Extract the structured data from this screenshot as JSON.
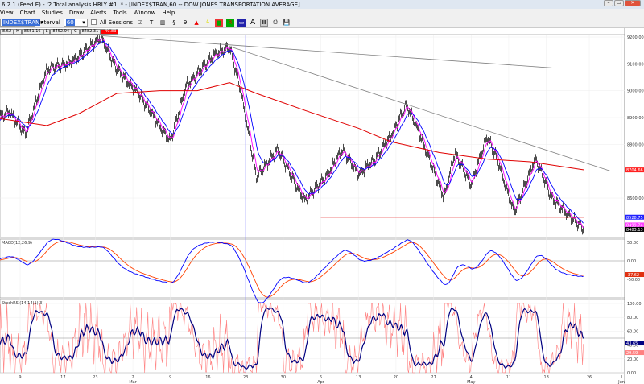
{
  "window": {
    "title": "6.2.1 (Feed E) - '2.Total analysis HRLY #1' * - [INDEX$TRAN,60 -- DOW JONES TRANSPORTATION AVERAGE]",
    "minimize": "–",
    "maximize": "▭",
    "close": "✕"
  },
  "menu": [
    "View",
    "Chart",
    "Studies",
    "Draw",
    "Alerts",
    "Tools",
    "Window",
    "Help"
  ],
  "toolbar": {
    "symbol": "INDEX$TRAN",
    "interval_label": "Interval",
    "interval": "60",
    "all_sessions": "All Sessions",
    "all_sessions_checked": false,
    "icons": [
      "check-chart-icon",
      "text-icon",
      "bars-icon",
      "spiral-icon",
      "nine-icon",
      "triangle-alert-icon",
      "lightning-icon",
      "color-bars-icon",
      "color-r-icon",
      "screen-icon",
      "font-a-icon",
      "grid-icon",
      "print-icon",
      "save-icon"
    ]
  },
  "infobar": {
    "o": "8.62",
    "h_label": "H",
    "h": "8551.16",
    "l_label": "L",
    "l": "8452.94",
    "c_label": "C",
    "c": "8482.31",
    "chg": "-40.83"
  },
  "colors": {
    "price": "#000000",
    "fast_ma": "#ff00ff",
    "mid_ma": "#0000ff",
    "slow_ma": "#e00000",
    "trendline": "#808080",
    "support": "#e00000",
    "macd": "#0000ff",
    "signal": "#ff4000",
    "stoch_k": "#ff8080",
    "stoch_d": "#000080",
    "cursor": "#4040ff"
  },
  "chart_data": {
    "type": "line",
    "title": "INDEX$TRAN,60 -- DOW JONES TRANSPORTATION AVERAGE",
    "price_axis": {
      "ticks": [
        "9200.00",
        "9100.00",
        "9000.00",
        "8900.00",
        "8800.00",
        "8600.00"
      ],
      "ylim": [
        8440,
        9215
      ]
    },
    "tags": [
      {
        "label": "8704.66",
        "value": 8704.66,
        "color": "#ff2020"
      },
      {
        "label": "8528.75",
        "value": 8528.75,
        "color": "#2020ff"
      },
      {
        "label": "8499.74",
        "value": 8499.74,
        "color": "#ff40ff"
      },
      {
        "label": "8483.13",
        "value": 8483.13,
        "color": "#000000"
      }
    ],
    "x_ticks": [
      {
        "d": "2015-02-09",
        "l": "9"
      },
      {
        "d": "2015-02-17",
        "l": "17"
      },
      {
        "d": "2015-02-23",
        "l": "23"
      },
      {
        "d": "2015-03-02",
        "l": "2",
        "m": "Mar"
      },
      {
        "d": "2015-03-09",
        "l": "9"
      },
      {
        "d": "2015-03-16",
        "l": "16"
      },
      {
        "d": "2015-03-23",
        "l": "23"
      },
      {
        "d": "2015-03-30",
        "l": "30"
      },
      {
        "d": "2015-04-06",
        "l": "6",
        "m": "Apr"
      },
      {
        "d": "2015-04-13",
        "l": "13"
      },
      {
        "d": "2015-04-20",
        "l": "20"
      },
      {
        "d": "2015-04-27",
        "l": "27"
      },
      {
        "d": "2015-05-04",
        "l": "4",
        "m": "May"
      },
      {
        "d": "2015-05-11",
        "l": "11"
      },
      {
        "d": "2015-05-18",
        "l": "18"
      },
      {
        "d": "2015-05-26",
        "l": "26"
      },
      {
        "d": "2015-06-01",
        "l": "1",
        "m": "Jun"
      }
    ],
    "close": [
      [
        "2015-02-04",
        8890
      ],
      [
        "2015-02-07",
        8920
      ],
      [
        "2015-02-10",
        8840
      ],
      [
        "2015-02-14",
        9080
      ],
      [
        "2015-02-19",
        9110
      ],
      [
        "2015-02-24",
        9200
      ],
      [
        "2015-02-27",
        9080
      ],
      [
        "2015-03-03",
        8990
      ],
      [
        "2015-03-09",
        8810
      ],
      [
        "2015-03-12",
        9020
      ],
      [
        "2015-03-17",
        9130
      ],
      [
        "2015-03-20",
        9165
      ],
      [
        "2015-03-22",
        9010
      ],
      [
        "2015-03-25",
        8680
      ],
      [
        "2015-03-29",
        8780
      ],
      [
        "2015-04-03",
        8590
      ],
      [
        "2015-04-07",
        8680
      ],
      [
        "2015-04-10",
        8780
      ],
      [
        "2015-04-13",
        8690
      ],
      [
        "2015-04-16",
        8740
      ],
      [
        "2015-04-19",
        8830
      ],
      [
        "2015-04-22",
        8950
      ],
      [
        "2015-04-25",
        8810
      ],
      [
        "2015-04-29",
        8600
      ],
      [
        "2015-05-01",
        8770
      ],
      [
        "2015-05-04",
        8650
      ],
      [
        "2015-05-07",
        8830
      ],
      [
        "2015-05-09",
        8740
      ],
      [
        "2015-05-12",
        8545
      ],
      [
        "2015-05-16",
        8750
      ],
      [
        "2015-05-19",
        8600
      ],
      [
        "2015-05-25",
        8483
      ]
    ],
    "ma200": [
      [
        "2015-02-04",
        8900
      ],
      [
        "2015-02-14",
        8870
      ],
      [
        "2015-02-20",
        8915
      ],
      [
        "2015-02-27",
        8990
      ],
      [
        "2015-03-07",
        9000
      ],
      [
        "2015-03-14",
        9000
      ],
      [
        "2015-03-20",
        9030
      ],
      [
        "2015-03-25",
        8990
      ],
      [
        "2015-04-04",
        8920
      ],
      [
        "2015-04-13",
        8860
      ],
      [
        "2015-04-19",
        8810
      ],
      [
        "2015-04-28",
        8770
      ],
      [
        "2015-05-07",
        8745
      ],
      [
        "2015-05-15",
        8735
      ],
      [
        "2015-05-25",
        8705
      ]
    ],
    "trendlines": [
      {
        "from": [
          "2015-02-24",
          9205
        ],
        "to": [
          "2015-05-19",
          9085
        ],
        "color": "#808080"
      },
      {
        "from": [
          "2015-03-20",
          9165
        ],
        "to": [
          "2015-05-30",
          8700
        ],
        "color": "#808080"
      }
    ],
    "support": {
      "from": "2015-04-06",
      "to": "2015-05-25",
      "value": 8528.75
    },
    "cursor_date": "2015-03-23",
    "macd": {
      "label": "MACD(12,26,9)",
      "ticks": [
        "50.00",
        "0.00",
        "-50.00"
      ],
      "tag": "-37.62"
    },
    "stoch": {
      "label": "StochRSI(14,14(1),3)",
      "ticks": [
        "100.00",
        "80.00",
        "60.00",
        "40.00",
        "20.00",
        "0.00"
      ],
      "tag_d": "43.65",
      "tag_k": "29.59"
    }
  }
}
